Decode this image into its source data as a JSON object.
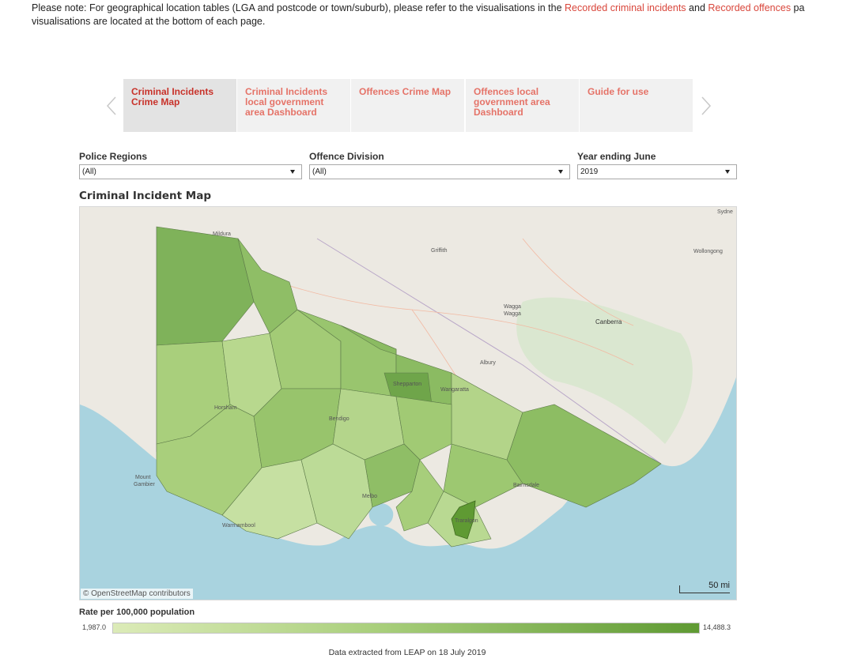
{
  "note": {
    "prefix": "Please note: For geographical location tables (LGA and postcode or town/suburb), please refer to the visualisations in the ",
    "link1": "Recorded criminal incidents",
    "middle": " and ",
    "link2": "Recorded offences",
    "suffix": " pa",
    "line2": "visualisations are located at the bottom of each page."
  },
  "tabs": [
    {
      "label": "Criminal Incidents Crime Map",
      "active": true
    },
    {
      "label": "Criminal Incidents local government area Dashboard",
      "active": false
    },
    {
      "label": "Offences Crime Map",
      "active": false
    },
    {
      "label": "Offences local government area Dashboard",
      "active": false
    },
    {
      "label": "Guide for use",
      "active": false
    }
  ],
  "filters": {
    "police_regions": {
      "label": "Police Regions",
      "value": "(All)"
    },
    "offence_division": {
      "label": "Offence Division",
      "value": "(All)"
    },
    "year": {
      "label": "Year ending June",
      "value": "2019"
    }
  },
  "map": {
    "title": "Criminal Incident Map",
    "credit": "© OpenStreetMap contributors",
    "scale_label": "50 mi",
    "place_labels": [
      "Sydne",
      "Wollongong",
      "Griffith",
      "Mildura",
      "Wagga Wagga",
      "Canberra",
      "Albury",
      "Shepparton",
      "Wangaratta",
      "Horsham",
      "Bendigo",
      "Mount Gambier",
      "Melbo",
      "Warrnambool",
      "Traralgon",
      "Bairnsdale"
    ]
  },
  "legend": {
    "title": "Rate per 100,000 population",
    "min": "1,987.0",
    "max": "14,488.3",
    "colors": {
      "low": "#dcebb8",
      "mid": "#a9cf7c",
      "high": "#5f9a33"
    }
  },
  "footer": "Data extracted from LEAP on 18 July 2019"
}
